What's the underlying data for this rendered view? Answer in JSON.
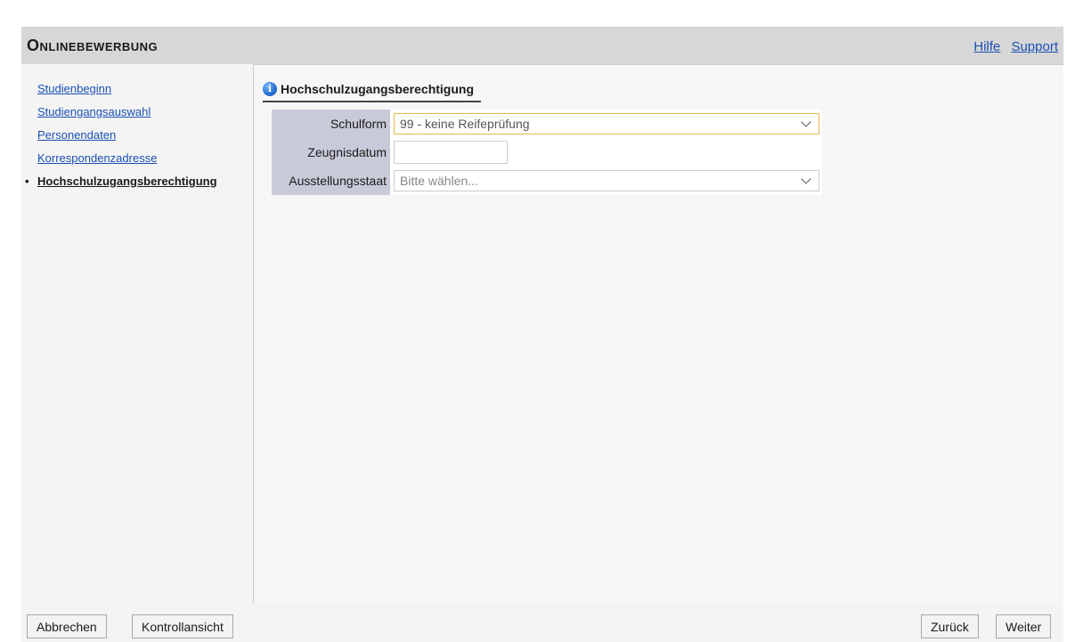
{
  "header": {
    "title": "Onlinebewerbung",
    "links": {
      "help": "Hilfe",
      "support": "Support"
    }
  },
  "sidebar": {
    "items": [
      {
        "label": "Studienbeginn"
      },
      {
        "label": "Studiengangsauswahl"
      },
      {
        "label": "Personendaten"
      },
      {
        "label": "Korrespondenzadresse"
      },
      {
        "label": "Hochschulzugangsberechtigung",
        "active": true
      }
    ]
  },
  "main": {
    "section_title": "Hochschulzugangsberechtigung",
    "form": {
      "schulform": {
        "label": "Schulform",
        "value": "99 - keine Reifeprüfung"
      },
      "zeugnisdatum": {
        "label": "Zeugnisdatum",
        "value": ""
      },
      "ausstellungsstaat": {
        "label": "Ausstellungsstaat",
        "placeholder": "Bitte wählen..."
      }
    }
  },
  "footer": {
    "cancel": "Abbrechen",
    "review": "Kontrollansicht",
    "back": "Zurück",
    "next": "Weiter"
  },
  "icons": {
    "section_icon": "info-icon",
    "select_icon": "chevron-down-icon"
  }
}
